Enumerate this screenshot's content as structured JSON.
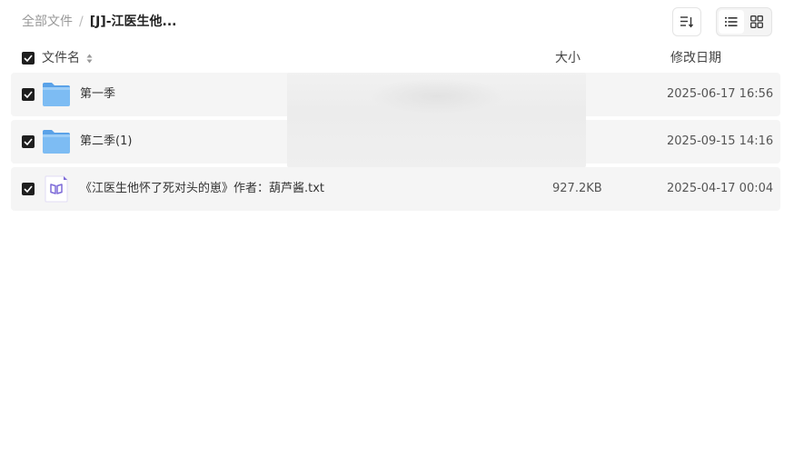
{
  "breadcrumb": {
    "root": "全部文件",
    "separator": "/",
    "current": "[J]-江医生他..."
  },
  "toolbar": {
    "sort_icon": "sort-lines-icon",
    "list_view_icon": "list-view-icon",
    "grid_view_icon": "grid-view-icon",
    "active_view": "list"
  },
  "table": {
    "headers": {
      "name": "文件名",
      "size": "大小",
      "date": "修改日期"
    },
    "rows": [
      {
        "name": "第一季",
        "size": "",
        "date": "2025-06-17 16:56",
        "type": "folder",
        "icon": "folder-icon",
        "checked": true
      },
      {
        "name": "第二季(1)",
        "size": "",
        "date": "2025-09-15 14:16",
        "type": "folder",
        "icon": "folder-icon",
        "checked": true
      },
      {
        "name": "《江医生他怀了死对头的崽》作者：葫芦酱.txt",
        "size": "927.2KB",
        "date": "2025-04-17 00:04",
        "type": "txt",
        "icon": "book-file-icon",
        "checked": true
      }
    ]
  },
  "colors": {
    "checkbox": "#1f1f1f",
    "row_background": "#f5f5f5",
    "folder": "#6fb3f0",
    "txt_icon_accent": "#7d6ad8"
  }
}
